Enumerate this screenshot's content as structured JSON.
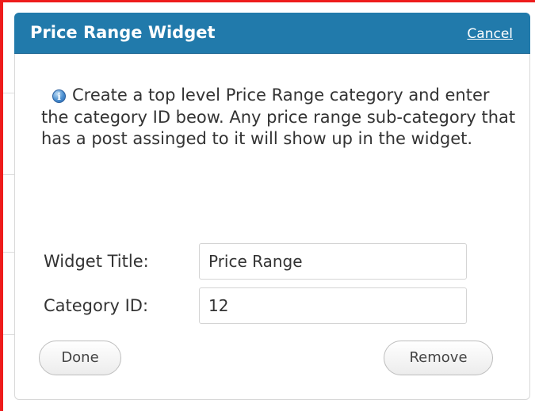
{
  "widget": {
    "title": "Price Range Widget",
    "cancel_label": "Cancel",
    "info_icon": "info-icon",
    "info_text": "Create a top level Price Range category and enter the category ID beow. Any price range sub-category that has a post assinged to it will show up in the widget.",
    "fields": [
      {
        "label": "Widget Title:",
        "value": "Price Range"
      },
      {
        "label": "Category ID:",
        "value": "12"
      }
    ],
    "done_label": "Done",
    "remove_label": "Remove"
  },
  "colors": {
    "header_bg": "#217aab",
    "frame": "#ee1c1c"
  }
}
